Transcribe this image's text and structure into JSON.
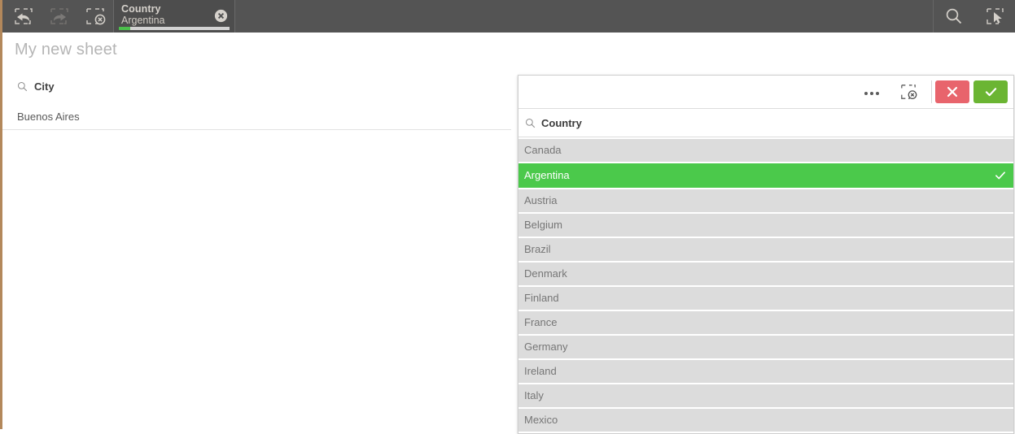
{
  "top_bar": {
    "nav_tools": [
      {
        "name": "step-back-selection",
        "icon": "selection-back-icon",
        "title": "Step back in selections",
        "enabled": true
      },
      {
        "name": "step-forward-selection",
        "icon": "selection-forward-icon",
        "title": "Step forward in selections",
        "enabled": false
      },
      {
        "name": "clear-all-selections",
        "icon": "selection-clear-icon",
        "title": "Clear all selections",
        "enabled": true
      }
    ],
    "selection_chip": {
      "field": "Country",
      "value": "Argentina",
      "close_icon": "close-circle-icon",
      "state_bar_fill_color": "#4cbf4c",
      "state_bar_track_color": "#d2d2d2"
    },
    "right_tools": [
      {
        "name": "smart-search",
        "icon": "search-icon",
        "title": "Smart search"
      },
      {
        "name": "selections-tool",
        "icon": "selections-tool-icon",
        "title": "Selections"
      }
    ],
    "background_color": "#545454"
  },
  "sheet": {
    "title": "My new sheet",
    "city_listbox": {
      "field_label": "City",
      "search_icon": "search-icon",
      "rows": [
        "Buenos Aires"
      ]
    }
  },
  "country_popup": {
    "toolbar": {
      "menu_icon": "more-options-icon",
      "clear_icon": "selection-clear-icon",
      "cancel_icon": "cross-icon",
      "confirm_icon": "check-icon",
      "cancel_color": "#e8646c",
      "confirm_color": "#6bb533"
    },
    "search": {
      "icon": "search-icon",
      "label": "Country",
      "placeholder": ""
    },
    "selected_value": "Argentina",
    "selected_color": "#4bc94b",
    "row_color": "#dcdcdc",
    "rows": [
      {
        "label": "Canada",
        "selected": false
      },
      {
        "label": "Argentina",
        "selected": true
      },
      {
        "label": "Austria",
        "selected": false
      },
      {
        "label": "Belgium",
        "selected": false
      },
      {
        "label": "Brazil",
        "selected": false
      },
      {
        "label": "Denmark",
        "selected": false
      },
      {
        "label": "Finland",
        "selected": false
      },
      {
        "label": "France",
        "selected": false
      },
      {
        "label": "Germany",
        "selected": false
      },
      {
        "label": "Ireland",
        "selected": false
      },
      {
        "label": "Italy",
        "selected": false
      },
      {
        "label": "Mexico",
        "selected": false
      }
    ]
  }
}
